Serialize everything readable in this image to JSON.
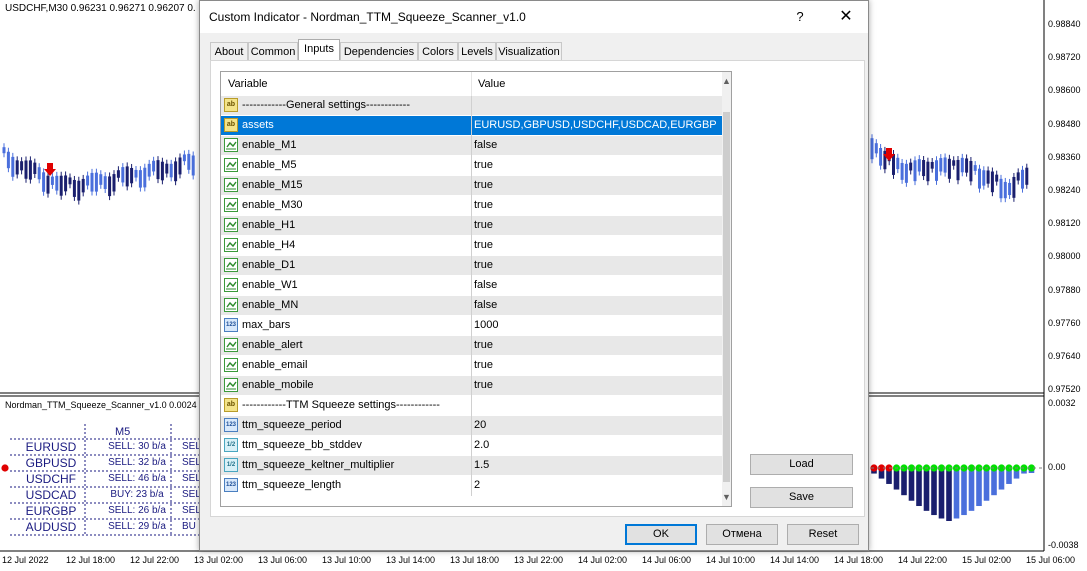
{
  "chart": {
    "title": "USDCHF,M30  0.96231 0.96271 0.96207 0.",
    "subwindow_title": "Nordman_TTM_Squeeze_Scanner_v1.0 0.0024",
    "price_labels": [
      "0.98840",
      "0.98720",
      "0.98600",
      "0.98480",
      "0.98360",
      "0.98240",
      "0.98120",
      "0.98000",
      "0.97880",
      "0.97760",
      "0.97640",
      "0.97520"
    ],
    "sub_price_labels": [
      "0.0032",
      "0.00",
      "-0.0038"
    ],
    "time_labels": [
      "12 Jul 2022",
      "12 Jul 18:00",
      "12 Jul 22:00",
      "13 Jul 02:00",
      "13 Jul 06:00",
      "13 Jul 10:00",
      "13 Jul 14:00",
      "13 Jul 18:00",
      "13 Jul 22:00",
      "14 Jul 02:00",
      "14 Jul 06:00",
      "14 Jul 10:00",
      "14 Jul 14:00",
      "14 Jul 18:00",
      "14 Jul 22:00",
      "15 Jul 02:00",
      "15 Jul 06:00"
    ],
    "scanner": {
      "timeframe": "M5",
      "rows": [
        {
          "symbol": "EURUSD",
          "signal": "SELL: 30 b/a",
          "next": "SELL"
        },
        {
          "symbol": "GBPUSD",
          "signal": "SELL: 32 b/a",
          "next": "SELL"
        },
        {
          "symbol": "USDCHF",
          "signal": "SELL: 46 b/a",
          "next": "SELL"
        },
        {
          "symbol": "USDCAD",
          "signal": "BUY: 23 b/a",
          "next": "SELL"
        },
        {
          "symbol": "EURGBP",
          "signal": "SELL: 26 b/a",
          "next": "SELL"
        },
        {
          "symbol": "AUDUSD",
          "signal": "SELL: 29 b/a",
          "next": "BU"
        }
      ]
    },
    "colors": {
      "bull": "#4a6fdc",
      "bear": "#1a1f6e",
      "signal": "#e00000",
      "squeeze_on": "#e00000",
      "squeeze_off": "#00e000"
    }
  },
  "dialog": {
    "title": "Custom Indicator - Nordman_TTM_Squeeze_Scanner_v1.0",
    "help": "?",
    "close": "✕",
    "tabs": [
      "About",
      "Common",
      "Inputs",
      "Dependencies",
      "Colors",
      "Levels",
      "Visualization"
    ],
    "active_tab": "Inputs",
    "columns": {
      "variable": "Variable",
      "value": "Value"
    },
    "params": [
      {
        "icon": "ab",
        "name": "------------General settings------------",
        "value": ""
      },
      {
        "icon": "ab",
        "name": "assets",
        "value": "EURUSD,GBPUSD,USDCHF,USDCAD,EURGBP",
        "selected": true
      },
      {
        "icon": "bool",
        "name": "enable_M1",
        "value": "false"
      },
      {
        "icon": "bool",
        "name": "enable_M5",
        "value": "true"
      },
      {
        "icon": "bool",
        "name": "enable_M15",
        "value": "true"
      },
      {
        "icon": "bool",
        "name": "enable_M30",
        "value": "true"
      },
      {
        "icon": "bool",
        "name": "enable_H1",
        "value": "true"
      },
      {
        "icon": "bool",
        "name": "enable_H4",
        "value": "true"
      },
      {
        "icon": "bool",
        "name": "enable_D1",
        "value": "true"
      },
      {
        "icon": "bool",
        "name": "enable_W1",
        "value": "false"
      },
      {
        "icon": "bool",
        "name": "enable_MN",
        "value": "false"
      },
      {
        "icon": "int",
        "name": "max_bars",
        "value": "1000"
      },
      {
        "icon": "bool",
        "name": "enable_alert",
        "value": "true"
      },
      {
        "icon": "bool",
        "name": "enable_email",
        "value": "true"
      },
      {
        "icon": "bool",
        "name": "enable_mobile",
        "value": "true"
      },
      {
        "icon": "ab",
        "name": "------------TTM Squeeze settings------------",
        "value": ""
      },
      {
        "icon": "int",
        "name": "ttm_squeeze_period",
        "value": "20"
      },
      {
        "icon": "dbl",
        "name": "ttm_squeeze_bb_stddev",
        "value": "2.0"
      },
      {
        "icon": "dbl",
        "name": "ttm_squeeze_keltner_multiplier",
        "value": "1.5"
      },
      {
        "icon": "int",
        "name": "ttm_squeeze_length",
        "value": "2"
      }
    ],
    "icon_text": {
      "ab": "ab",
      "int": "123",
      "dbl": "1/2",
      "bool": ""
    },
    "buttons": {
      "load": "Load",
      "save": "Save",
      "ok": "OK",
      "cancel": "Отмена",
      "reset": "Reset"
    }
  }
}
